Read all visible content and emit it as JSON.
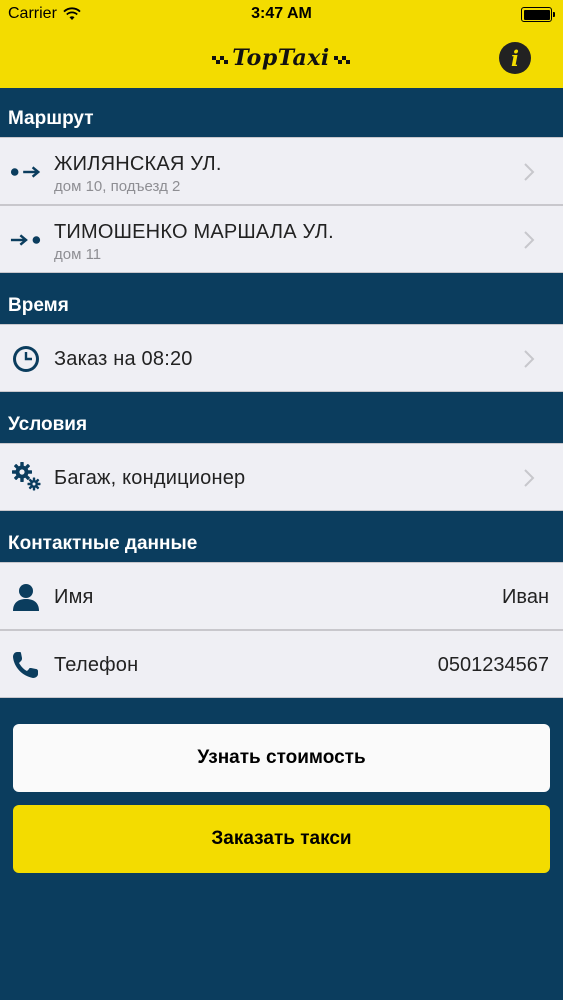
{
  "status_bar": {
    "carrier": "Carrier",
    "time": "3:47 AM",
    "battery_level": 1.0
  },
  "header": {
    "logo_text": "TopTaxi",
    "info_label": "i"
  },
  "route": {
    "heading": "Маршрут",
    "from": {
      "street": "ЖИЛЯНСКАЯ УЛ.",
      "details": "дом 10, подъезд 2",
      "icon": "route-start-icon"
    },
    "to": {
      "street": "ТИМОШЕНКО МАРШАЛА УЛ.",
      "details": "дом 11",
      "icon": "route-end-icon"
    }
  },
  "time": {
    "heading": "Время",
    "label": "Заказ на 08:20",
    "icon": "clock-icon"
  },
  "conditions": {
    "heading": "Условия",
    "label": "Багаж, кондиционер",
    "icon": "gears-icon"
  },
  "contacts": {
    "heading": "Контактные данные",
    "name": {
      "label": "Имя",
      "value": "Иван",
      "icon": "user-icon"
    },
    "phone": {
      "label": "Телефон",
      "value": "0501234567",
      "icon": "phone-icon"
    }
  },
  "buttons": {
    "price_label": "Узнать стоимость",
    "order_label": "Заказать такси"
  },
  "colors": {
    "brand_yellow": "#f3dc00",
    "navy": "#0b3d5e",
    "row_bg": "#efeff4",
    "icon_blue": "#0b3d5e"
  }
}
